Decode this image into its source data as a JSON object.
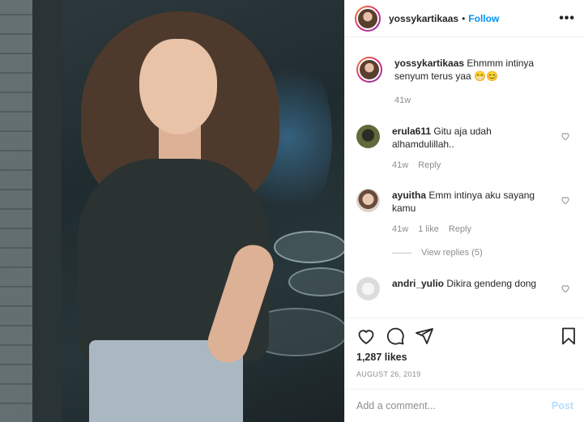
{
  "post": {
    "username": "yossykartikaas",
    "follow_label": "Follow",
    "separator": "•",
    "more_label": "•••"
  },
  "caption": {
    "username": "yossykartikaas",
    "text": "Ehmmm intinya senyum terus yaa",
    "emoji": "😁😊",
    "time": "41w"
  },
  "comments": [
    {
      "username": "erula611",
      "text": "Gitu aja udah alhamdulillah..",
      "time": "41w",
      "likes": "",
      "reply": "Reply"
    },
    {
      "username": "ayuitha",
      "text": "Emm intinya aku sayang kamu",
      "time": "41w",
      "likes": "1 like",
      "reply": "Reply",
      "view_replies": "View replies (5)"
    },
    {
      "username": "andri_yulio",
      "text": "Dikira gendeng dong"
    }
  ],
  "actions": {
    "like_icon": "heart-icon",
    "comment_icon": "comment-icon",
    "share_icon": "share-icon",
    "save_icon": "bookmark-icon"
  },
  "likes": "1,287 likes",
  "date": "AUGUST 26, 2019",
  "add_comment": {
    "placeholder": "Add a comment...",
    "post_label": "Post"
  },
  "colors": {
    "link": "#0095f6",
    "muted": "#8e8e8e",
    "post_disabled": "#b2dffc"
  }
}
